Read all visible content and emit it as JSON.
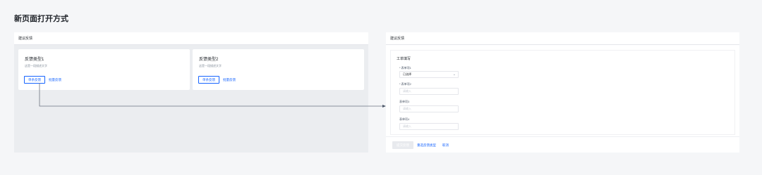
{
  "page": {
    "title": "新页面打开方式"
  },
  "left_panel": {
    "header": "建议反馈",
    "cards": [
      {
        "title": "反馈类型1",
        "desc": "这是一段描述文字",
        "primary": "单条反馈",
        "secondary": "批量反馈"
      },
      {
        "title": "反馈类型2",
        "desc": "这是一段描述文字",
        "primary": "单条反馈",
        "secondary": "批量反馈"
      }
    ]
  },
  "right_panel": {
    "header": "建议反馈",
    "form_title": "工单填写",
    "fields": [
      {
        "label": "* 表单项1",
        "value": "已选择",
        "type": "select"
      },
      {
        "label": "* 表单项2",
        "placeholder": "请输入"
      },
      {
        "label": "表单项3",
        "placeholder": "请输入"
      },
      {
        "label": "表单项4",
        "placeholder": "请输入"
      }
    ],
    "footer": {
      "submit": "提交反馈",
      "reselect": "重选反馈类型",
      "cancel": "取消"
    }
  },
  "colors": {
    "accent": "#1664ff",
    "bg": "#f5f6f8",
    "panel_bg": "#ebedf0",
    "disabled": "#e8eaee"
  },
  "icons": {
    "select_arrow": "chevron-down-icon",
    "connector": "arrow-connector"
  }
}
